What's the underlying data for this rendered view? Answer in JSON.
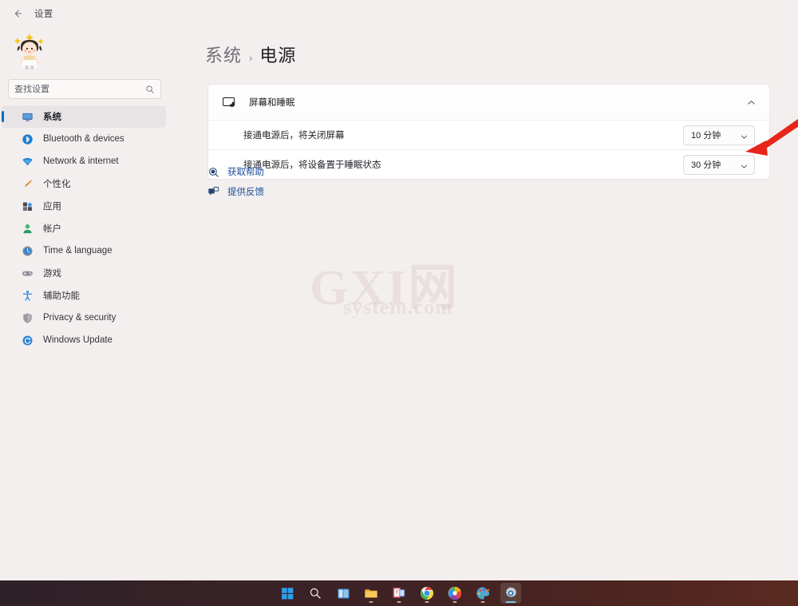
{
  "window": {
    "title": "设置",
    "back_icon": "back-arrow-icon"
  },
  "sidebar": {
    "avatar": "user-avatar",
    "search": {
      "placeholder": "查找设置",
      "value": "",
      "icon": "search-icon"
    },
    "items": [
      {
        "label": "系统",
        "icon": "monitor-icon",
        "active": true
      },
      {
        "label": "Bluetooth & devices",
        "icon": "bluetooth-icon",
        "active": false
      },
      {
        "label": "Network & internet",
        "icon": "wifi-icon",
        "active": false
      },
      {
        "label": "个性化",
        "icon": "paintbrush-icon",
        "active": false
      },
      {
        "label": "应用",
        "icon": "apps-grid-icon",
        "active": false
      },
      {
        "label": "帐户",
        "icon": "person-icon",
        "active": false
      },
      {
        "label": "Time & language",
        "icon": "clock-globe-icon",
        "active": false
      },
      {
        "label": "游戏",
        "icon": "gamepad-icon",
        "active": false
      },
      {
        "label": "辅助功能",
        "icon": "accessibility-icon",
        "active": false
      },
      {
        "label": "Privacy & security",
        "icon": "shield-icon",
        "active": false
      },
      {
        "label": "Windows Update",
        "icon": "update-icon",
        "active": false
      }
    ]
  },
  "main": {
    "breadcrumb": {
      "root": "系统",
      "separator": "›",
      "current": "电源"
    },
    "card": {
      "header_title": "屏幕和睡眠",
      "header_icon": "screen-sleep-icon",
      "collapse_icon": "chevron-up-icon",
      "rows": [
        {
          "label": "接通电源后，将关闭屏幕",
          "dropdown_value": "10 分钟",
          "dropdown_icon": "chevron-down-icon"
        },
        {
          "label": "接通电源后，将设备置于睡眠状态",
          "dropdown_value": "30 分钟",
          "dropdown_icon": "chevron-down-icon"
        }
      ]
    },
    "links": [
      {
        "label": "获取帮助",
        "icon": "help-icon"
      },
      {
        "label": "提供反馈",
        "icon": "feedback-icon"
      }
    ],
    "watermark": {
      "main": "GXI网",
      "sub": "system.com"
    },
    "annotation": {
      "shape": "red-arrow",
      "color": "#e8251b"
    }
  },
  "taskbar": {
    "items": [
      {
        "name": "start-button",
        "icon": "windows-logo-icon",
        "active": false,
        "running": false
      },
      {
        "name": "search-button",
        "icon": "search-icon",
        "active": false,
        "running": false
      },
      {
        "name": "task-view-button",
        "icon": "task-view-icon",
        "active": false,
        "running": false
      },
      {
        "name": "file-explorer-button",
        "icon": "folder-icon",
        "active": false,
        "running": true
      },
      {
        "name": "microsoft-store-button",
        "icon": "store-icon",
        "active": false,
        "running": true
      },
      {
        "name": "chrome-button",
        "icon": "chrome-icon",
        "active": false,
        "running": true
      },
      {
        "name": "browser-button",
        "icon": "colorful-browser-icon",
        "active": false,
        "running": true
      },
      {
        "name": "paint-button",
        "icon": "paint-palette-icon",
        "active": false,
        "running": true
      },
      {
        "name": "settings-button",
        "icon": "gear-icon",
        "active": true,
        "running": true
      }
    ]
  },
  "colors": {
    "accent": "#0b6bb8",
    "link": "#1b4f99",
    "page_background": "#f4efef",
    "card_background": "#ffffff",
    "annotation_red": "#e8251b"
  }
}
